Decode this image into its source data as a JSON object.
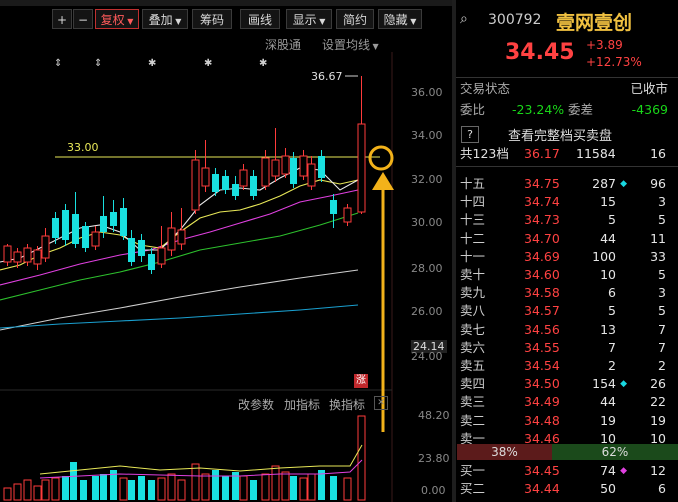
{
  "toolbar": {
    "plus": "+",
    "minus": "−",
    "fuquan": "复权",
    "diejia": "叠加",
    "chouma": "筹码",
    "huaxian": "画线",
    "xianshi": "显示",
    "jianyue": "简约",
    "yincang": "隐藏",
    "chart_link_1": "深股通",
    "chart_link_2": "设置均线"
  },
  "chart": {
    "high_label": "36.67",
    "level_label": "33.00",
    "y_ticks": [
      "36.00",
      "34.00",
      "32.00",
      "30.00",
      "28.00",
      "26.00",
      "24.14",
      "24.00"
    ],
    "zhang_badge": "涨",
    "ind_links": [
      "改参数",
      "加指标",
      "换指标"
    ],
    "vol_ticks": [
      "48.20",
      "23.80",
      "0.00"
    ]
  },
  "stock": {
    "code": "300792",
    "name": "壹网壹创",
    "price": "34.45",
    "change": "+3.89",
    "change_pct": "+12.73%",
    "status_label": "交易状态",
    "status_value": "已收市",
    "weibi_label": "委比",
    "weibi_value": "-23.24%",
    "weicha_label": "委差",
    "weicha_value": "-4369",
    "help_icon": "?",
    "full_book": "查看完整档买卖盘",
    "total_label": "共123档",
    "total_price": "36.17",
    "total_vol": "11584",
    "total_count": "16",
    "ratio_buy": "38%",
    "ratio_sell": "62%"
  },
  "asks": [
    {
      "label": "十五",
      "price": "34.75",
      "vol": "287",
      "count": "96",
      "mark": "diamond-cyan"
    },
    {
      "label": "十四",
      "price": "34.74",
      "vol": "15",
      "count": "3"
    },
    {
      "label": "十三",
      "price": "34.73",
      "vol": "5",
      "count": "5"
    },
    {
      "label": "十二",
      "price": "34.70",
      "vol": "44",
      "count": "11"
    },
    {
      "label": "十一",
      "price": "34.69",
      "vol": "100",
      "count": "33"
    },
    {
      "label": "卖十",
      "price": "34.60",
      "vol": "10",
      "count": "5"
    },
    {
      "label": "卖九",
      "price": "34.58",
      "vol": "6",
      "count": "3"
    },
    {
      "label": "卖八",
      "price": "34.57",
      "vol": "5",
      "count": "5"
    },
    {
      "label": "卖七",
      "price": "34.56",
      "vol": "13",
      "count": "7"
    },
    {
      "label": "卖六",
      "price": "34.55",
      "vol": "7",
      "count": "7"
    },
    {
      "label": "卖五",
      "price": "34.54",
      "vol": "2",
      "count": "2"
    },
    {
      "label": "卖四",
      "price": "34.50",
      "vol": "154",
      "count": "26",
      "mark": "diamond-cyan"
    },
    {
      "label": "卖三",
      "price": "34.49",
      "vol": "44",
      "count": "22"
    },
    {
      "label": "卖二",
      "price": "34.48",
      "vol": "19",
      "count": "19"
    },
    {
      "label": "卖一",
      "price": "34.46",
      "vol": "10",
      "count": "10"
    }
  ],
  "bids": [
    {
      "label": "买一",
      "price": "34.45",
      "vol": "74",
      "count": "12",
      "mark": "diamond-magenta"
    },
    {
      "label": "买二",
      "price": "34.44",
      "vol": "50",
      "count": "6"
    }
  ]
}
